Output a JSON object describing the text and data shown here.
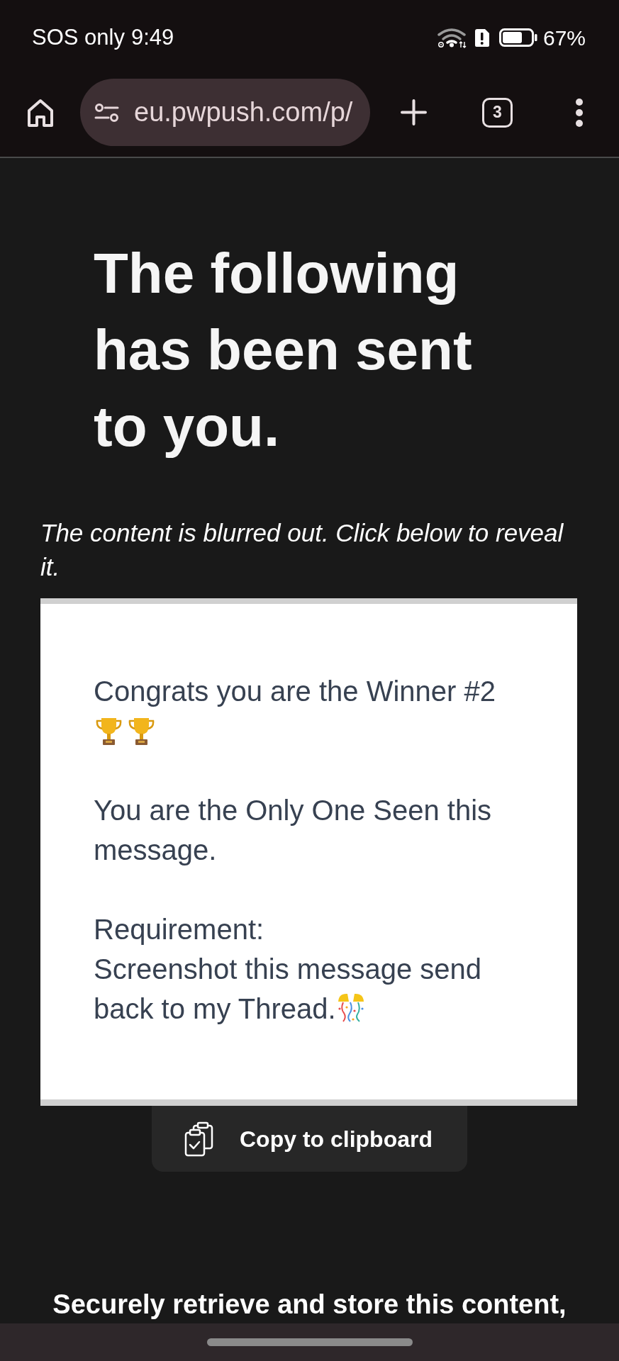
{
  "status_bar": {
    "carrier": "SOS only",
    "time": "9:49",
    "battery": "67%"
  },
  "browser": {
    "url": "eu.pwpush.com/p/",
    "tab_count": "3"
  },
  "page": {
    "heading": "The following has been sent to you.",
    "notice": "The content is blurred out. Click below to reveal it.",
    "message": {
      "paragraphs": [
        [
          "Congrats you are the Winner #2"
        ],
        [
          "You are the Only One Seen this message."
        ],
        [
          "Requirement:",
          "Screenshot this message send",
          "back to my Thread."
        ]
      ]
    },
    "copy_button": "Copy to clipboard",
    "footer": "Securely retrieve and store this content,"
  }
}
